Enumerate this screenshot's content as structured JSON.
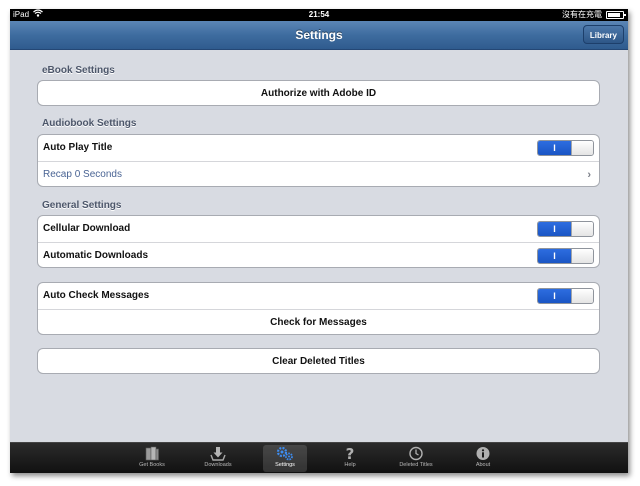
{
  "status_bar": {
    "device": "iPad",
    "time": "21:54",
    "battery_text": "沒有在充電"
  },
  "nav_bar": {
    "title": "Settings",
    "library_button": "Library"
  },
  "sections": {
    "ebook": {
      "header": "eBook Settings",
      "authorize_label": "Authorize with Adobe ID"
    },
    "audiobook": {
      "header": "Audiobook Settings",
      "auto_play_label": "Auto Play Title",
      "auto_play_toggle": "I",
      "recap_label": "Recap",
      "recap_value": "0 Seconds",
      "recap_chevron": "›"
    },
    "general": {
      "header": "General Settings",
      "cellular_label": "Cellular Download",
      "cellular_toggle": "I",
      "automatic_label": "Automatic Downloads",
      "automatic_toggle": "I"
    },
    "messages": {
      "auto_check_label": "Auto Check Messages",
      "auto_check_toggle": "I",
      "check_button": "Check for Messages"
    },
    "clear": {
      "clear_button": "Clear Deleted Titles"
    }
  },
  "tab_bar": {
    "tabs": [
      {
        "label": "Get Books",
        "icon": "get-books-icon"
      },
      {
        "label": "Downloads",
        "icon": "downloads-icon"
      },
      {
        "label": "Settings",
        "icon": "gears-icon",
        "selected": true
      },
      {
        "label": "Help",
        "icon": "question-icon"
      },
      {
        "label": "Deleted Titles",
        "icon": "clock-icon"
      },
      {
        "label": "About",
        "icon": "info-icon"
      }
    ]
  },
  "colors": {
    "nav_bar": "#3e6c9f",
    "background": "#d8dbe2",
    "toggle_on": "#1f5fd4",
    "value_text": "#4a6494"
  }
}
